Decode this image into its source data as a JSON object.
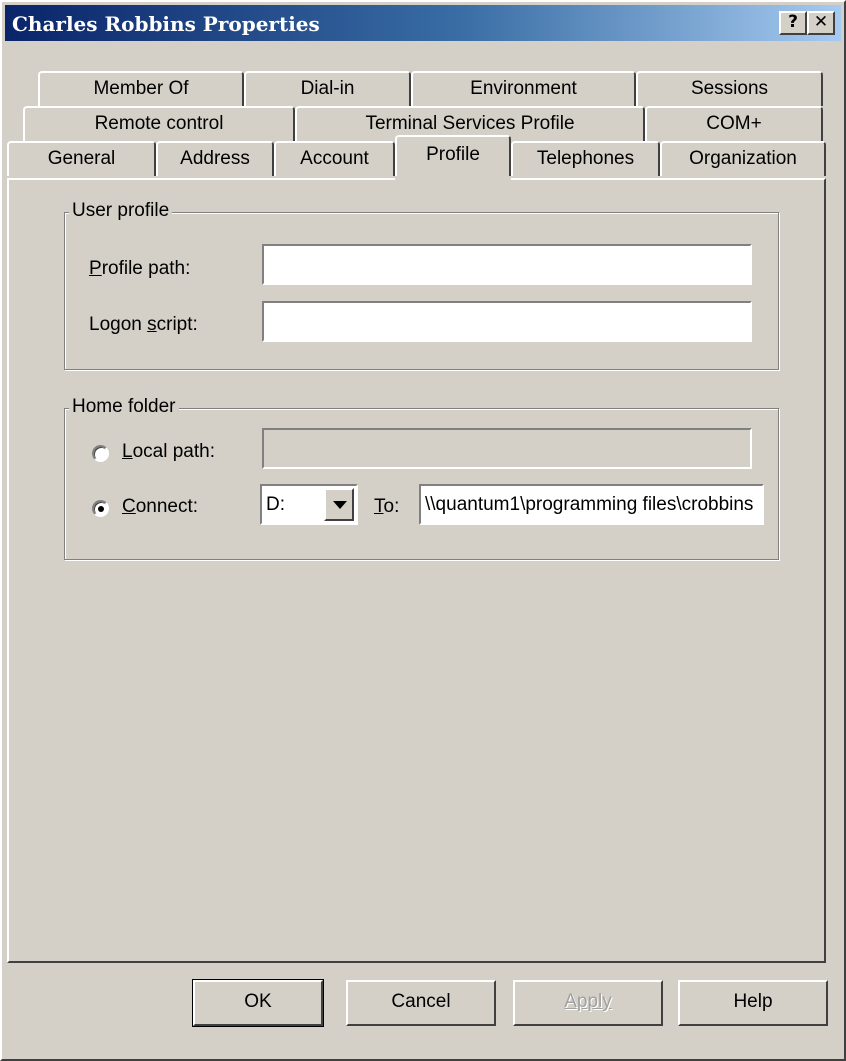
{
  "window": {
    "title": "Charles Robbins Properties",
    "help_label": "?",
    "close_label": "✕"
  },
  "tabs": {
    "row1": [
      "Member Of",
      "Dial-in",
      "Environment",
      "Sessions"
    ],
    "row2": [
      "Remote control",
      "Terminal Services Profile",
      "COM+"
    ],
    "row3": [
      "General",
      "Address",
      "Account",
      "Profile",
      "Telephones",
      "Organization"
    ],
    "selected": "Profile"
  },
  "user_profile": {
    "legend": "User profile",
    "profile_path": {
      "mnemonic": "P",
      "rest": "rofile path:",
      "value": ""
    },
    "logon_script": {
      "prefix": "Logon ",
      "mnemonic": "s",
      "rest": "cript:",
      "value": ""
    }
  },
  "home_folder": {
    "legend": "Home folder",
    "local_path": {
      "mnemonic": "L",
      "rest": "ocal path:",
      "value": "",
      "selected": false
    },
    "connect": {
      "mnemonic": "C",
      "rest": "onnect:",
      "selected": true
    },
    "drive": "D:",
    "to": {
      "mnemonic": "T",
      "rest": "o:"
    },
    "to_value": "\\\\quantum1\\programming files\\crobbins"
  },
  "buttons": {
    "ok": "OK",
    "cancel": "Cancel",
    "apply": "Apply",
    "help": "Help"
  }
}
